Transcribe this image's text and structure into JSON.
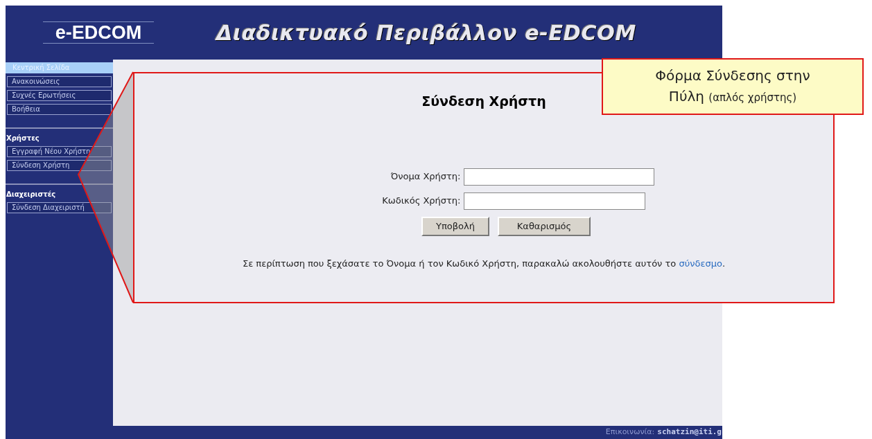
{
  "header": {
    "logo": "e-EDCOM",
    "title": "Διαδικτυακό Περιβάλλον e-EDCOM"
  },
  "sidebar": {
    "sections": [
      {
        "items": [
          {
            "label": "Κεντρική Σελίδα",
            "selected": true
          },
          {
            "label": "Ανακοινώσεις",
            "selected": false
          },
          {
            "label": "Συχνές Ερωτήσεις",
            "selected": false
          },
          {
            "label": "Βοήθεια",
            "selected": false
          }
        ]
      },
      {
        "heading": "Χρήστες",
        "items": [
          {
            "label": "Εγγραφή Νέου Χρήστη",
            "selected": false
          },
          {
            "label": "Σύνδεση Χρήστη",
            "selected": false
          }
        ]
      },
      {
        "heading": "Διαχειριστές",
        "items": [
          {
            "label": "Σύνδεση Διαχειριστή",
            "selected": false
          }
        ]
      }
    ]
  },
  "login_form": {
    "title": "Σύνδεση Χρήστη",
    "fields": [
      {
        "label": "Όνομα Χρήστη:",
        "kind": "text"
      },
      {
        "label": "Κωδικός Χρήστη:",
        "kind": "password"
      }
    ],
    "buttons": [
      "Υποβολή",
      "Καθαρισμός"
    ],
    "help_text": "Σε περίπτωση που ξεχάσατε το Όνομα ή τον Κωδικό Χρήστη, παρακαλώ ακολουθήστε αυτόν το",
    "help_link": "σύνδεσμο",
    "help_end": "."
  },
  "footer": {
    "label": "Επικοινωνία:",
    "email": "schatzin@iti.g"
  },
  "callout": {
    "title": "Φόρμα Σύνδεσης στην Πύλη",
    "note": "(απλός χρήστης)"
  }
}
